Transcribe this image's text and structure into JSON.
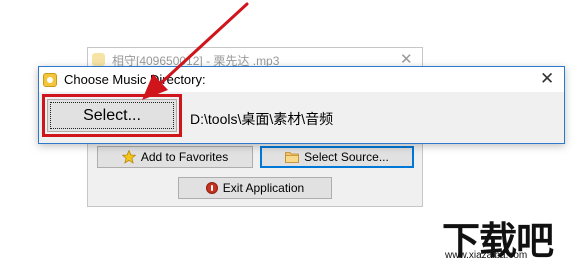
{
  "background_window": {
    "title": "相守[409650012] - 栗先达 .mp3",
    "close_glyph": "✕",
    "add_favorites_label": "Add to Favorites",
    "select_source_label": "Select Source...",
    "exit_label": "Exit Application"
  },
  "dialog": {
    "title": "Choose Music Directory:",
    "close_glyph": "✕",
    "select_button_label": "Select...",
    "path": "D:\\tools\\桌面\\素材\\音频"
  },
  "annotation": {
    "highlight_color": "#d0141c",
    "arrow_color": "#d0141c"
  },
  "watermark": {
    "logo_text": "下载吧",
    "url": "www.xiazaiba.com"
  },
  "icons": {
    "star": "star-icon",
    "folder": "folder-icon",
    "power": "power-icon",
    "app": "app-icon"
  }
}
